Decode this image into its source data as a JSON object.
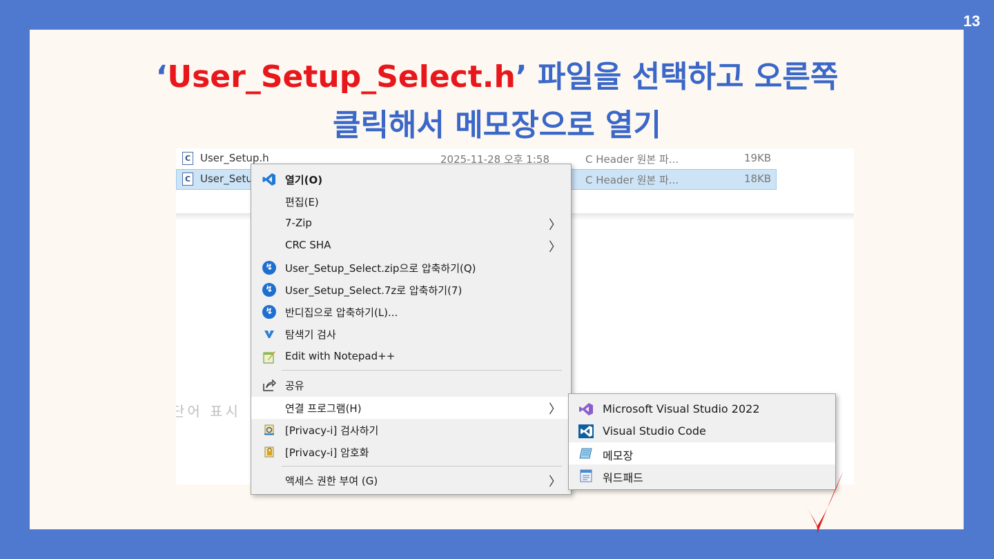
{
  "page_number": "13",
  "title": {
    "open_quote": "‘",
    "filename": "User_Setup_Select.h",
    "close_quote": "’",
    "line1_rest": " 파일을 선택하고 오른쪽",
    "line2": "클릭해서 메모장으로 열기"
  },
  "explorer": {
    "files": [
      {
        "name": "User_Setup.h",
        "date": "2025-11-28 오후 1:58",
        "type": "C Header 원본 파...",
        "size": "19KB"
      },
      {
        "name": "User_Setu",
        "date": "",
        "type": "C Header 원본 파...",
        "size": "18KB"
      }
    ],
    "ghost_text": "단어 표시"
  },
  "context_menu": {
    "items": [
      {
        "label": "열기(O)",
        "icon": "vscode-icon"
      },
      {
        "label": "편집(E)",
        "icon": ""
      },
      {
        "label": "7-Zip",
        "icon": "",
        "submenu": true
      },
      {
        "label": "CRC SHA",
        "icon": "",
        "submenu": true
      },
      {
        "label": "User_Setup_Select.zip으로 압축하기(Q)",
        "icon": "bandizip-icon"
      },
      {
        "label": "User_Setup_Select.7z로 압축하기(7)",
        "icon": "bandizip-icon"
      },
      {
        "label": "반디집으로 압축하기(L)...",
        "icon": "bandizip-icon"
      },
      {
        "label": "탐색기 검사",
        "icon": "scan-icon"
      },
      {
        "label": "Edit with Notepad++",
        "icon": "notepadpp-icon"
      },
      {
        "label": "공유",
        "icon": "share-icon"
      },
      {
        "label": "연결 프로그램(H)",
        "icon": "",
        "submenu": true
      },
      {
        "label": "[Privacy-i] 검사하기",
        "icon": "privacy-scan-icon"
      },
      {
        "label": "[Privacy-i] 암호화",
        "icon": "privacy-lock-icon"
      },
      {
        "label": "액세스 권한 부여 (G)",
        "icon": "",
        "submenu": true
      }
    ],
    "arrow": "〉"
  },
  "open_with_submenu": {
    "items": [
      {
        "label": "Microsoft Visual Studio 2022",
        "icon": "visual-studio-icon"
      },
      {
        "label": "Visual Studio Code",
        "icon": "vscode-icon"
      },
      {
        "label": "메모장",
        "icon": "notepad-icon"
      },
      {
        "label": "워드패드",
        "icon": "wordpad-icon"
      }
    ]
  },
  "colors": {
    "background": "#4f78cf",
    "slide": "#fdf8f1",
    "title_blue": "#3a67c8",
    "title_red": "#e8171c",
    "checkmark": "#e41b1b"
  }
}
